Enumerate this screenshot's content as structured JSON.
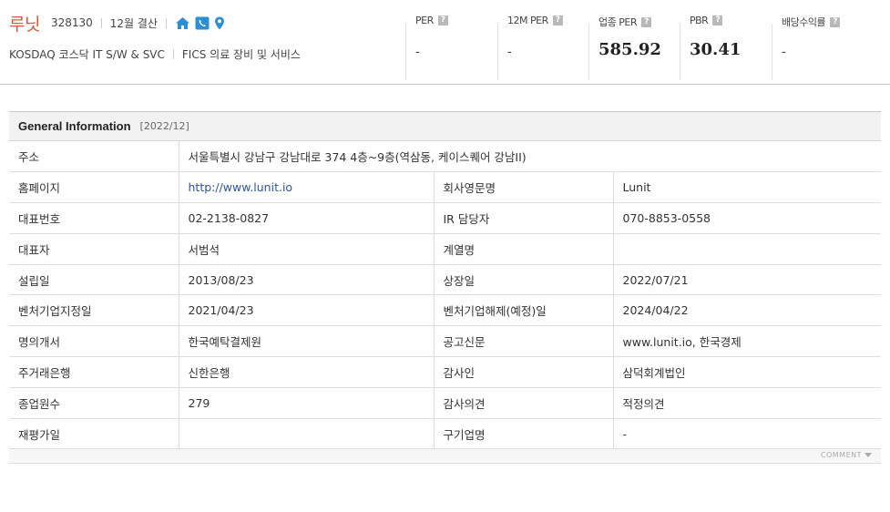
{
  "company": {
    "name": "루닛",
    "code": "328130",
    "settlement": "12월 결산",
    "market": "KOSDAQ  코스닥 IT S/W & SVC",
    "fics": "FICS 의료 장비 및 서비스",
    "icons": [
      "home-icon",
      "phone-icon",
      "location-icon"
    ],
    "name_color": "#e0573c",
    "icon_color": "#2b8fd1"
  },
  "metrics": [
    {
      "label": "PER",
      "value": "-"
    },
    {
      "label": "12M PER",
      "value": "-"
    },
    {
      "label": "업종 PER",
      "value": "585.92"
    },
    {
      "label": "PBR",
      "value": "30.41"
    },
    {
      "label": "배당수익률",
      "value": "-"
    }
  ],
  "help_glyph": "?",
  "general": {
    "title": "General Information",
    "date": "[2022/12]",
    "address_label": "주소",
    "address_value": "서울특별시 강남구 강남대로 374 4층~9층(역삼동, 케이스퀘어 강남II)",
    "rows": [
      {
        "l1": "홈페이지",
        "v1": "http://www.lunit.io",
        "l2": "회사영문명",
        "v2": "Lunit"
      },
      {
        "l1": "대표번호",
        "v1": "02-2138-0827",
        "l2": "IR 담당자",
        "v2": "070-8853-0558"
      },
      {
        "l1": "대표자",
        "v1": "서범석",
        "l2": "계열명",
        "v2": ""
      },
      {
        "l1": "설립일",
        "v1": "2013/08/23",
        "l2": "상장일",
        "v2": "2022/07/21"
      },
      {
        "l1": "벤처기업지정일",
        "v1": "2021/04/23",
        "l2": "벤처기업해제(예정)일",
        "v2": "2024/04/22"
      },
      {
        "l1": "명의개서",
        "v1": "한국예탁결제원",
        "l2": "공고신문",
        "v2": "www.lunit.io, 한국경제"
      },
      {
        "l1": "주거래은행",
        "v1": "신한은행",
        "l2": "감사인",
        "v2": "삼덕회계법인"
      },
      {
        "l1": "종업원수",
        "v1": "279",
        "l2": "감사의견",
        "v2": "적정의견"
      },
      {
        "l1": "재평가일",
        "v1": "",
        "l2": "구기업명",
        "v2": "-"
      }
    ],
    "comment_label": "COMMENT"
  }
}
